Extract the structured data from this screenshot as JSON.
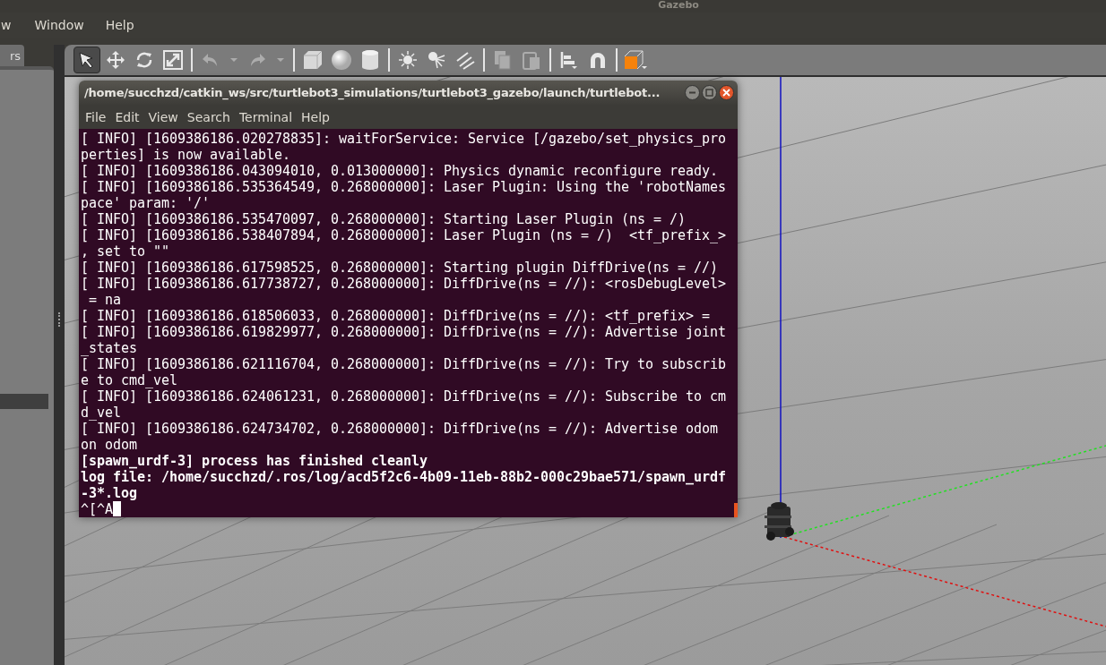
{
  "app_title": "Gazebo",
  "menu": [
    "w",
    "Window",
    "Help"
  ],
  "left_panel": {
    "tab": "rs"
  },
  "toolbar": [
    {
      "selected": true,
      "disabled": false
    },
    {
      "selected": false,
      "disabled": false
    },
    {
      "selected": false,
      "disabled": false
    },
    {
      "selected": false,
      "disabled": false
    },
    {
      "selected": false,
      "disabled": true
    },
    {
      "selected": false,
      "disabled": true
    },
    {
      "selected": false,
      "disabled": true
    },
    {
      "selected": false,
      "disabled": true
    },
    {
      "selected": false,
      "disabled": false
    },
    {
      "selected": false,
      "disabled": false
    },
    {
      "selected": false,
      "disabled": false
    },
    {
      "selected": false,
      "disabled": false
    },
    {
      "selected": false,
      "disabled": false
    },
    {
      "selected": false,
      "disabled": false
    },
    {
      "selected": false,
      "disabled": true
    },
    {
      "selected": false,
      "disabled": true
    },
    {
      "selected": false,
      "disabled": false
    },
    {
      "selected": false,
      "disabled": false
    },
    {
      "selected": false,
      "disabled": false
    }
  ],
  "terminal": {
    "title": "/home/succhzd/catkin_ws/src/turtlebot3_simulations/turtlebot3_gazebo/launch/turtlebot...",
    "menu": [
      "File",
      "Edit",
      "View",
      "Search",
      "Terminal",
      "Help"
    ],
    "lines": [
      {
        "text": "[ INFO] [1609386186.020278835]: waitForService: Service [/gazebo/set_physics_pro",
        "bold": false
      },
      {
        "text": "perties] is now available.",
        "bold": false
      },
      {
        "text": "[ INFO] [1609386186.043094010, 0.013000000]: Physics dynamic reconfigure ready.",
        "bold": false
      },
      {
        "text": "[ INFO] [1609386186.535364549, 0.268000000]: Laser Plugin: Using the 'robotNames",
        "bold": false
      },
      {
        "text": "pace' param: '/'",
        "bold": false
      },
      {
        "text": "[ INFO] [1609386186.535470097, 0.268000000]: Starting Laser Plugin (ns = /)",
        "bold": false
      },
      {
        "text": "[ INFO] [1609386186.538407894, 0.268000000]: Laser Plugin (ns = /)  <tf_prefix_>",
        "bold": false
      },
      {
        "text": ", set to \"\"",
        "bold": false
      },
      {
        "text": "[ INFO] [1609386186.617598525, 0.268000000]: Starting plugin DiffDrive(ns = //)",
        "bold": false
      },
      {
        "text": "[ INFO] [1609386186.617738727, 0.268000000]: DiffDrive(ns = //): <rosDebugLevel>",
        "bold": false
      },
      {
        "text": " = na",
        "bold": false
      },
      {
        "text": "[ INFO] [1609386186.618506033, 0.268000000]: DiffDrive(ns = //): <tf_prefix> =",
        "bold": false
      },
      {
        "text": "[ INFO] [1609386186.619829977, 0.268000000]: DiffDrive(ns = //): Advertise joint",
        "bold": false
      },
      {
        "text": "_states",
        "bold": false
      },
      {
        "text": "[ INFO] [1609386186.621116704, 0.268000000]: DiffDrive(ns = //): Try to subscrib",
        "bold": false
      },
      {
        "text": "e to cmd_vel",
        "bold": false
      },
      {
        "text": "[ INFO] [1609386186.624061231, 0.268000000]: DiffDrive(ns = //): Subscribe to cm",
        "bold": false
      },
      {
        "text": "d_vel",
        "bold": false
      },
      {
        "text": "[ INFO] [1609386186.624734702, 0.268000000]: DiffDrive(ns = //): Advertise odom",
        "bold": false
      },
      {
        "text": "on odom",
        "bold": false
      },
      {
        "text": "[spawn_urdf-3] process has finished cleanly",
        "bold": true
      },
      {
        "text": "log file: /home/succhzd/.ros/log/acd5f2c6-4b09-11eb-88b2-000c29bae571/spawn_urdf",
        "bold": true
      },
      {
        "text": "-3*.log",
        "bold": true
      }
    ],
    "prompt": "^[^A"
  }
}
